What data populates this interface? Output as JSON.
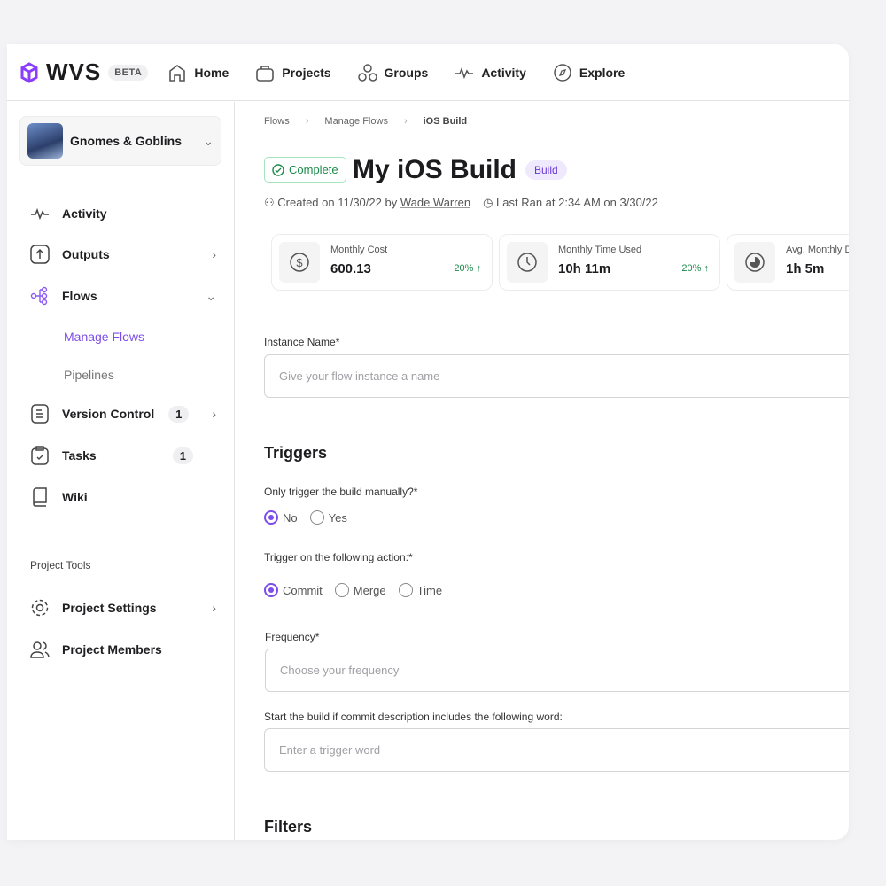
{
  "header": {
    "logo": "WVS",
    "beta": "BETA",
    "nav": [
      {
        "label": "Home",
        "icon": "home-icon"
      },
      {
        "label": "Projects",
        "icon": "bag-icon"
      },
      {
        "label": "Groups",
        "icon": "groups-icon"
      },
      {
        "label": "Activity",
        "icon": "activity-icon"
      },
      {
        "label": "Explore",
        "icon": "compass-icon"
      }
    ]
  },
  "sidebar": {
    "project": "Gnomes & Goblins",
    "items": [
      {
        "label": "Activity"
      },
      {
        "label": "Outputs"
      },
      {
        "label": "Flows"
      },
      {
        "label": "Version Control",
        "badge": "1"
      },
      {
        "label": "Tasks",
        "badge": "1"
      },
      {
        "label": "Wiki"
      }
    ],
    "sub_items": [
      "Manage Flows",
      "Pipelines"
    ],
    "section": "Project Tools",
    "tools": [
      {
        "label": "Project Settings"
      },
      {
        "label": "Project Members"
      }
    ]
  },
  "breadcrumb": [
    "Flows",
    "Manage Flows",
    "iOS Build"
  ],
  "page": {
    "status": "Complete",
    "title": "My iOS Build",
    "tag": "Build",
    "created": "Created on 11/30/22 by",
    "author": "Wade Warren",
    "last_ran": "Last Ran at 2:34 AM on 3/30/22"
  },
  "stats": [
    {
      "label": "Monthly Cost",
      "value": "600.13",
      "delta": "20% ↑"
    },
    {
      "label": "Monthly Time Used",
      "value": "10h 11m",
      "delta": "20% ↑"
    },
    {
      "label": "Avg. Monthly Duration",
      "value": "1h 5m"
    }
  ],
  "form": {
    "instance_label": "Instance Name*",
    "instance_placeholder": "Give your flow instance a name",
    "triggers": "Triggers",
    "manual_q": "Only trigger the build manually?*",
    "manual_opts": [
      "No",
      "Yes"
    ],
    "action_q": "Trigger on the following action:*",
    "action_opts": [
      "Commit",
      "Merge",
      "Time"
    ],
    "freq_label": "Frequency*",
    "freq_placeholder": "Choose your frequency",
    "word_label": "Start the build if commit description includes the following word:",
    "word_placeholder": "Enter a trigger word",
    "filters": "Filters"
  },
  "colors": {
    "accent": "#7c4dea",
    "success": "#1c8a4a"
  }
}
